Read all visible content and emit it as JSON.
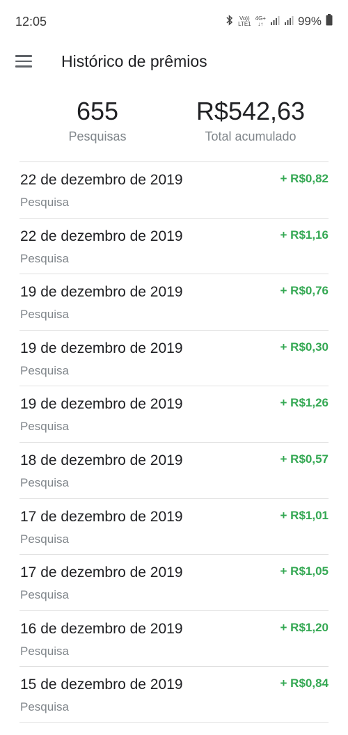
{
  "status_bar": {
    "time": "12:05",
    "battery": "99%",
    "volte_top": "Vo))",
    "volte_bottom": "LTE1",
    "net_top": "4G+",
    "net_bottom": "↓↑"
  },
  "header": {
    "title": "Histórico de prêmios"
  },
  "summary": {
    "surveys_count": "655",
    "surveys_label": "Pesquisas",
    "total_value": "R$542,63",
    "total_label": "Total acumulado"
  },
  "colors": {
    "amount": "#34a853",
    "secondary_text": "#80868b",
    "divider": "#e0e0e0"
  },
  "rewards": [
    {
      "date": "22 de dezembro de 2019",
      "type": "Pesquisa",
      "amount": "+ R$0,82"
    },
    {
      "date": "22 de dezembro de 2019",
      "type": "Pesquisa",
      "amount": "+ R$1,16"
    },
    {
      "date": "19 de dezembro de 2019",
      "type": "Pesquisa",
      "amount": "+ R$0,76"
    },
    {
      "date": "19 de dezembro de 2019",
      "type": "Pesquisa",
      "amount": "+ R$0,30"
    },
    {
      "date": "19 de dezembro de 2019",
      "type": "Pesquisa",
      "amount": "+ R$1,26"
    },
    {
      "date": "18 de dezembro de 2019",
      "type": "Pesquisa",
      "amount": "+ R$0,57"
    },
    {
      "date": "17 de dezembro de 2019",
      "type": "Pesquisa",
      "amount": "+ R$1,01"
    },
    {
      "date": "17 de dezembro de 2019",
      "type": "Pesquisa",
      "amount": "+ R$1,05"
    },
    {
      "date": "16 de dezembro de 2019",
      "type": "Pesquisa",
      "amount": "+ R$1,20"
    },
    {
      "date": "15 de dezembro de 2019",
      "type": "Pesquisa",
      "amount": "+ R$0,84"
    }
  ]
}
